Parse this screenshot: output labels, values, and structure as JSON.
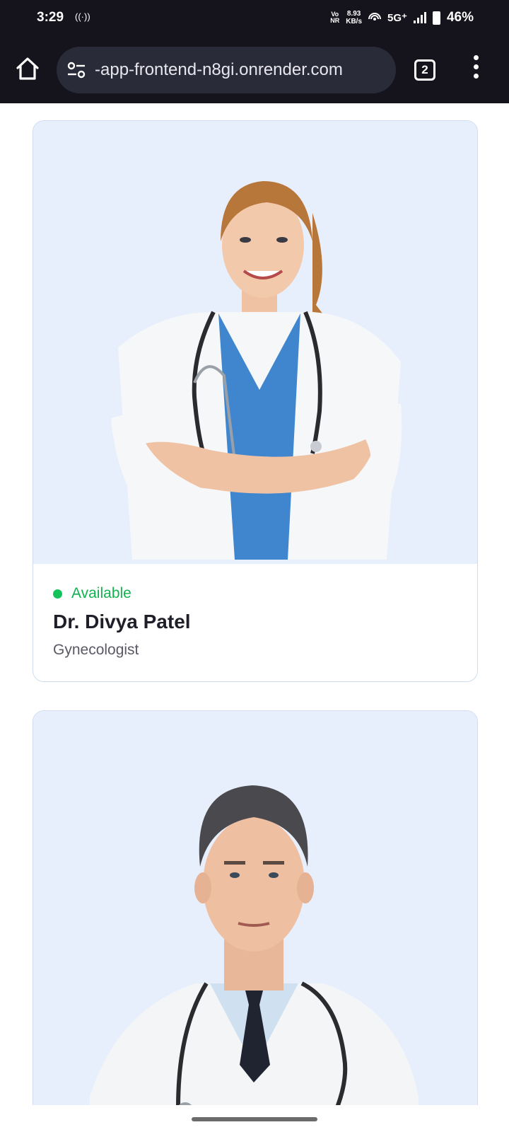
{
  "status_bar": {
    "time": "3:29",
    "hotspot_glyph": "((·))",
    "volte": [
      "Vo",
      "NR"
    ],
    "speed": [
      "8.93",
      "KB/s"
    ],
    "network": "5G⁺",
    "battery": "46%"
  },
  "browser": {
    "url": "-app-frontend-n8gi.onrender.com",
    "tab_count": "2"
  },
  "doctors": [
    {
      "status": "Available",
      "name": "Dr. Divya Patel",
      "specialty": "Gynecologist"
    },
    {
      "photo_label": "male doctor with stethoscope"
    }
  ],
  "colors": {
    "available_green": "#12b24f",
    "card_bg": "#e8effc",
    "card_border": "#cfdcf0",
    "topbar": "#15141d"
  },
  "icons": [
    "home-icon",
    "site-settings-icon",
    "tabs-icon",
    "more-vert-icon",
    "hotspot-icon",
    "signal-icon",
    "battery-icon"
  ]
}
